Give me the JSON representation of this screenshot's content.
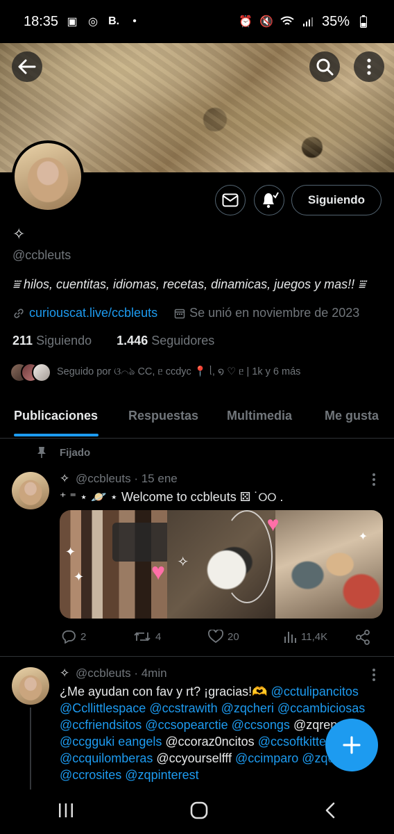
{
  "status_bar": {
    "time": "18:35",
    "battery": "35%"
  },
  "profile": {
    "name_glyph": "✧",
    "handle": "@ccbleuts",
    "bio": "⩸ hilos, cuentitas, idiomas, recetas, dinamicas, juegos y mas!! ⩸",
    "link": "curiouscat.live/ccbleuts",
    "joined": "Se unió en noviembre de 2023",
    "following_count": "211",
    "following_label": "Siguiendo",
    "followers_count": "1.446",
    "followers_label": "Seguidores",
    "followed_by": "Seguido por ଓ⌒ঌ CC, ᥱ ccdyc 📍 ᥣ, ໑ ♡ ᥱ | 1k y 6 más",
    "follow_button": "Siguiendo"
  },
  "tabs": [
    "Publicaciones",
    "Respuestas",
    "Multimedia",
    "Me gusta"
  ],
  "pinned_label": "Fijado",
  "tweets": [
    {
      "name": "✧",
      "handle": "@ccbleuts",
      "time": "· 15 ene",
      "text": "⁺ ⁼ ⋆ 🪐 ⋆ Welcome to ccbleuts ⚄ ˙୦୦ .",
      "replies": "2",
      "retweets": "4",
      "likes": "20",
      "views": "11,4K"
    },
    {
      "name": "✧",
      "handle": "@ccbleuts",
      "time": "· 4min",
      "lines": [
        {
          "plain": "¿Me ayudan con fav y rt? ¡gracias!🫶 ",
          "mentions": "@cctulipancitos"
        },
        {
          "plain": "",
          "mentions": "@Ccllittlespace @ccstrawith @zqcheri @ccambiciosas"
        },
        {
          "plain": "",
          "mentions": "@ccfriendsitos @ccsopearctie @ccsongs",
          "tail": " @zqrenm"
        },
        {
          "plain": "",
          "mentions": "@ccgguki eangels",
          "tail": " @ccoraz0ncitos",
          "mentions2": " @ccsoftkitten"
        },
        {
          "plain": "",
          "mentions": "@ccquilomberas",
          "tail": " @ccyourselfff",
          "mentions2": " @ccimparo @zqo"
        },
        {
          "plain": "",
          "mentions": "@ccrosites @zqpinterest"
        }
      ]
    }
  ],
  "colors": {
    "accent": "#1d9bf0",
    "background": "#000000",
    "muted": "#71767b"
  }
}
